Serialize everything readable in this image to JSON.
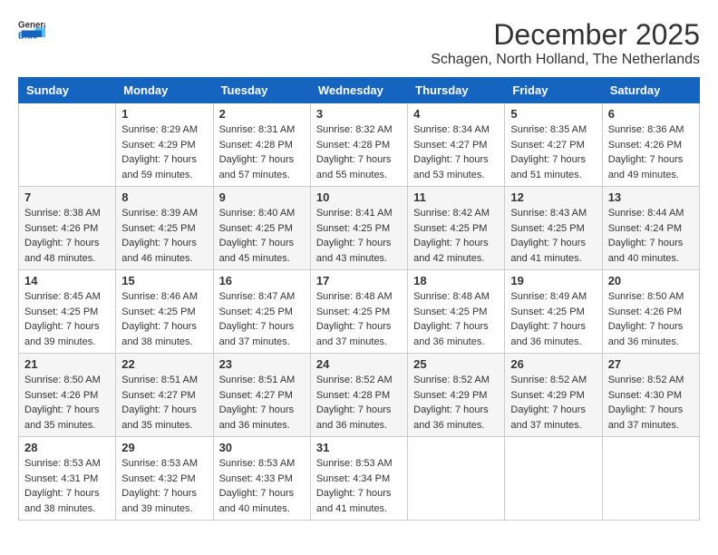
{
  "logo": {
    "general": "General",
    "blue": "Blue"
  },
  "title": {
    "month": "December 2025",
    "location": "Schagen, North Holland, The Netherlands"
  },
  "headers": [
    "Sunday",
    "Monday",
    "Tuesday",
    "Wednesday",
    "Thursday",
    "Friday",
    "Saturday"
  ],
  "weeks": [
    [
      {
        "day": "",
        "sunrise": "",
        "sunset": "",
        "daylight": ""
      },
      {
        "day": "1",
        "sunrise": "Sunrise: 8:29 AM",
        "sunset": "Sunset: 4:29 PM",
        "daylight": "Daylight: 7 hours and 59 minutes."
      },
      {
        "day": "2",
        "sunrise": "Sunrise: 8:31 AM",
        "sunset": "Sunset: 4:28 PM",
        "daylight": "Daylight: 7 hours and 57 minutes."
      },
      {
        "day": "3",
        "sunrise": "Sunrise: 8:32 AM",
        "sunset": "Sunset: 4:28 PM",
        "daylight": "Daylight: 7 hours and 55 minutes."
      },
      {
        "day": "4",
        "sunrise": "Sunrise: 8:34 AM",
        "sunset": "Sunset: 4:27 PM",
        "daylight": "Daylight: 7 hours and 53 minutes."
      },
      {
        "day": "5",
        "sunrise": "Sunrise: 8:35 AM",
        "sunset": "Sunset: 4:27 PM",
        "daylight": "Daylight: 7 hours and 51 minutes."
      },
      {
        "day": "6",
        "sunrise": "Sunrise: 8:36 AM",
        "sunset": "Sunset: 4:26 PM",
        "daylight": "Daylight: 7 hours and 49 minutes."
      }
    ],
    [
      {
        "day": "7",
        "sunrise": "Sunrise: 8:38 AM",
        "sunset": "Sunset: 4:26 PM",
        "daylight": "Daylight: 7 hours and 48 minutes."
      },
      {
        "day": "8",
        "sunrise": "Sunrise: 8:39 AM",
        "sunset": "Sunset: 4:25 PM",
        "daylight": "Daylight: 7 hours and 46 minutes."
      },
      {
        "day": "9",
        "sunrise": "Sunrise: 8:40 AM",
        "sunset": "Sunset: 4:25 PM",
        "daylight": "Daylight: 7 hours and 45 minutes."
      },
      {
        "day": "10",
        "sunrise": "Sunrise: 8:41 AM",
        "sunset": "Sunset: 4:25 PM",
        "daylight": "Daylight: 7 hours and 43 minutes."
      },
      {
        "day": "11",
        "sunrise": "Sunrise: 8:42 AM",
        "sunset": "Sunset: 4:25 PM",
        "daylight": "Daylight: 7 hours and 42 minutes."
      },
      {
        "day": "12",
        "sunrise": "Sunrise: 8:43 AM",
        "sunset": "Sunset: 4:25 PM",
        "daylight": "Daylight: 7 hours and 41 minutes."
      },
      {
        "day": "13",
        "sunrise": "Sunrise: 8:44 AM",
        "sunset": "Sunset: 4:24 PM",
        "daylight": "Daylight: 7 hours and 40 minutes."
      }
    ],
    [
      {
        "day": "14",
        "sunrise": "Sunrise: 8:45 AM",
        "sunset": "Sunset: 4:25 PM",
        "daylight": "Daylight: 7 hours and 39 minutes."
      },
      {
        "day": "15",
        "sunrise": "Sunrise: 8:46 AM",
        "sunset": "Sunset: 4:25 PM",
        "daylight": "Daylight: 7 hours and 38 minutes."
      },
      {
        "day": "16",
        "sunrise": "Sunrise: 8:47 AM",
        "sunset": "Sunset: 4:25 PM",
        "daylight": "Daylight: 7 hours and 37 minutes."
      },
      {
        "day": "17",
        "sunrise": "Sunrise: 8:48 AM",
        "sunset": "Sunset: 4:25 PM",
        "daylight": "Daylight: 7 hours and 37 minutes."
      },
      {
        "day": "18",
        "sunrise": "Sunrise: 8:48 AM",
        "sunset": "Sunset: 4:25 PM",
        "daylight": "Daylight: 7 hours and 36 minutes."
      },
      {
        "day": "19",
        "sunrise": "Sunrise: 8:49 AM",
        "sunset": "Sunset: 4:25 PM",
        "daylight": "Daylight: 7 hours and 36 minutes."
      },
      {
        "day": "20",
        "sunrise": "Sunrise: 8:50 AM",
        "sunset": "Sunset: 4:26 PM",
        "daylight": "Daylight: 7 hours and 36 minutes."
      }
    ],
    [
      {
        "day": "21",
        "sunrise": "Sunrise: 8:50 AM",
        "sunset": "Sunset: 4:26 PM",
        "daylight": "Daylight: 7 hours and 35 minutes."
      },
      {
        "day": "22",
        "sunrise": "Sunrise: 8:51 AM",
        "sunset": "Sunset: 4:27 PM",
        "daylight": "Daylight: 7 hours and 35 minutes."
      },
      {
        "day": "23",
        "sunrise": "Sunrise: 8:51 AM",
        "sunset": "Sunset: 4:27 PM",
        "daylight": "Daylight: 7 hours and 36 minutes."
      },
      {
        "day": "24",
        "sunrise": "Sunrise: 8:52 AM",
        "sunset": "Sunset: 4:28 PM",
        "daylight": "Daylight: 7 hours and 36 minutes."
      },
      {
        "day": "25",
        "sunrise": "Sunrise: 8:52 AM",
        "sunset": "Sunset: 4:29 PM",
        "daylight": "Daylight: 7 hours and 36 minutes."
      },
      {
        "day": "26",
        "sunrise": "Sunrise: 8:52 AM",
        "sunset": "Sunset: 4:29 PM",
        "daylight": "Daylight: 7 hours and 37 minutes."
      },
      {
        "day": "27",
        "sunrise": "Sunrise: 8:52 AM",
        "sunset": "Sunset: 4:30 PM",
        "daylight": "Daylight: 7 hours and 37 minutes."
      }
    ],
    [
      {
        "day": "28",
        "sunrise": "Sunrise: 8:53 AM",
        "sunset": "Sunset: 4:31 PM",
        "daylight": "Daylight: 7 hours and 38 minutes."
      },
      {
        "day": "29",
        "sunrise": "Sunrise: 8:53 AM",
        "sunset": "Sunset: 4:32 PM",
        "daylight": "Daylight: 7 hours and 39 minutes."
      },
      {
        "day": "30",
        "sunrise": "Sunrise: 8:53 AM",
        "sunset": "Sunset: 4:33 PM",
        "daylight": "Daylight: 7 hours and 40 minutes."
      },
      {
        "day": "31",
        "sunrise": "Sunrise: 8:53 AM",
        "sunset": "Sunset: 4:34 PM",
        "daylight": "Daylight: 7 hours and 41 minutes."
      },
      {
        "day": "",
        "sunrise": "",
        "sunset": "",
        "daylight": ""
      },
      {
        "day": "",
        "sunrise": "",
        "sunset": "",
        "daylight": ""
      },
      {
        "day": "",
        "sunrise": "",
        "sunset": "",
        "daylight": ""
      }
    ]
  ]
}
